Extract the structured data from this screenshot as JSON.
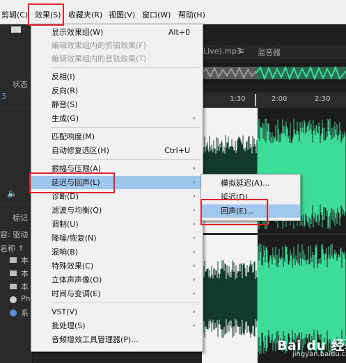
{
  "menubar": {
    "items": [
      "剪辑(C)",
      "效果(S)",
      "收藏夹(R)",
      "视图(V)",
      "窗口(W)",
      "帮助(H)"
    ]
  },
  "left_panel": {
    "status_label": "状态",
    "file_prefix": "3",
    "markers_label": "标记",
    "content_label": "容: 驱动",
    "name_label": "名称 ↑",
    "items": [
      "本",
      "本",
      "本",
      "Ph",
      "系"
    ]
  },
  "editor": {
    "tab_file": "Live).mp3",
    "tab_mixer": "混音器",
    "ruler_ticks": [
      "1:30",
      "2:00",
      "2:30"
    ]
  },
  "effects_menu": {
    "items": [
      {
        "label": "显示效果组(W)",
        "shortcut": "Alt+0"
      },
      {
        "label": "编辑效果组内的剪辑效果(F)",
        "disabled": true
      },
      {
        "label": "编辑效果组内的音轨效果(T)",
        "disabled": true
      },
      {
        "label": "反相(I)"
      },
      {
        "label": "反向(R)"
      },
      {
        "label": "静音(S)"
      },
      {
        "label": "生成(G)",
        "submenu": true
      },
      {
        "label": "匹配响度(M)"
      },
      {
        "label": "自动修复选区(H)",
        "shortcut": "Ctrl+U"
      },
      {
        "label": "振幅与压限(A)",
        "submenu": true
      },
      {
        "label": "延迟与回声(L)",
        "submenu": true,
        "active": true
      },
      {
        "label": "诊断(D)",
        "submenu": true
      },
      {
        "label": "滤波与均衡(Q)",
        "submenu": true
      },
      {
        "label": "调制(U)",
        "submenu": true
      },
      {
        "label": "降噪/恢复(N)",
        "submenu": true
      },
      {
        "label": "混响(B)",
        "submenu": true
      },
      {
        "label": "特殊效果(C)",
        "submenu": true
      },
      {
        "label": "立体声声像(O)",
        "submenu": true
      },
      {
        "label": "时间与变调(E)",
        "submenu": true
      },
      {
        "label": "VST(V)",
        "submenu": true
      },
      {
        "label": "批处理(S)",
        "submenu": true
      },
      {
        "label": "音频增效工具管理器(P)..."
      }
    ],
    "arrow_glyph": "›"
  },
  "delay_submenu": {
    "items": [
      {
        "label": "模拟延迟(A)..."
      },
      {
        "label": "延迟(D)..."
      },
      {
        "label": "回声(E)...",
        "active": true
      }
    ]
  },
  "watermark": {
    "brand": "Bai du 经验",
    "url": "jingyan.baidu.com"
  },
  "colors": {
    "highlight_box": "#e0232b",
    "waveform": "#3ddc9a",
    "waveform_selected": "#123a2c",
    "menu_active": "#9fc7ee"
  }
}
